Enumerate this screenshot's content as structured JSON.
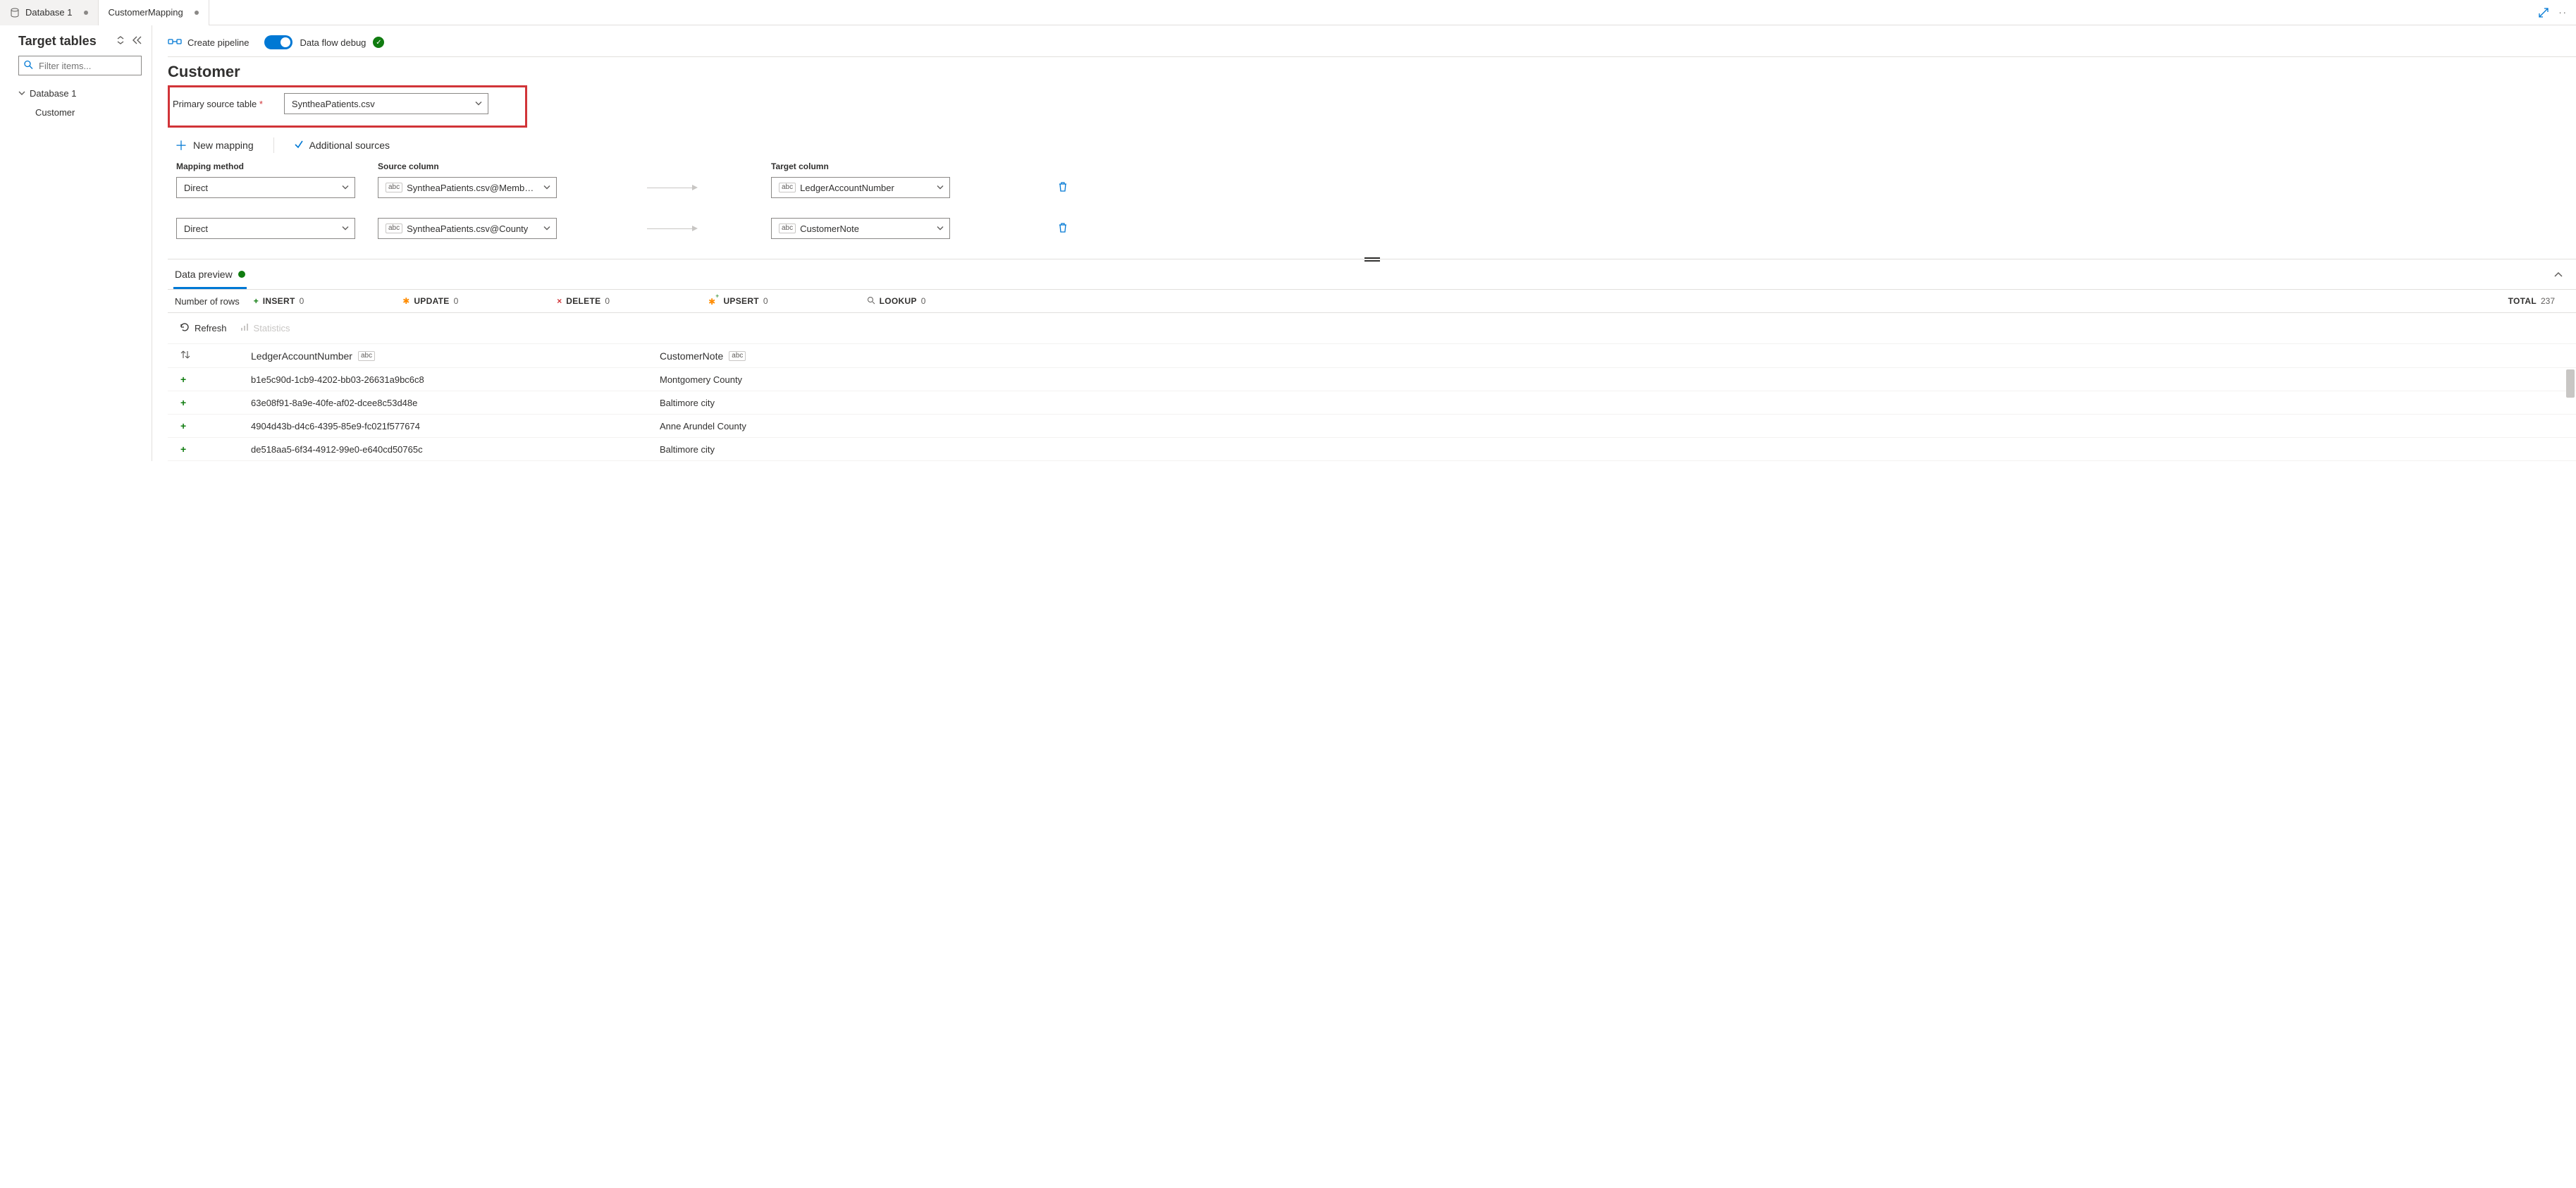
{
  "tabs": [
    {
      "label": "Database 1",
      "active": false
    },
    {
      "label": "CustomerMapping",
      "active": true
    }
  ],
  "sidebar": {
    "title": "Target tables",
    "filter_placeholder": "Filter items...",
    "tree": {
      "root_label": "Database 1",
      "children": [
        {
          "label": "Customer"
        }
      ]
    }
  },
  "toolbar": {
    "create_pipeline": "Create pipeline",
    "debug_label": "Data flow debug",
    "debug_on": true
  },
  "heading": "Customer",
  "primary_source": {
    "label": "Primary source table",
    "required": true,
    "value": "SyntheaPatients.csv"
  },
  "mapping_actions": {
    "new_mapping": "New mapping",
    "additional_sources": "Additional sources"
  },
  "mapping_header": {
    "method": "Mapping method",
    "source": "Source column",
    "target": "Target column"
  },
  "mappings": [
    {
      "method": "Direct",
      "source": "SyntheaPatients.csv@Member id",
      "target": "LedgerAccountNumber"
    },
    {
      "method": "Direct",
      "source": "SyntheaPatients.csv@County",
      "target": "CustomerNote"
    }
  ],
  "preview": {
    "tab_label": "Data preview",
    "rows_label": "Number of rows",
    "stats": {
      "insert": {
        "label": "INSERT",
        "value": "0"
      },
      "update": {
        "label": "UPDATE",
        "value": "0"
      },
      "delete": {
        "label": "DELETE",
        "value": "0"
      },
      "upsert": {
        "label": "UPSERT",
        "value": "0"
      },
      "lookup": {
        "label": "LOOKUP",
        "value": "0"
      },
      "total": {
        "label": "TOTAL",
        "value": "237"
      }
    },
    "refresh_label": "Refresh",
    "statistics_label": "Statistics",
    "columns": [
      {
        "name": "LedgerAccountNumber",
        "type": "abc"
      },
      {
        "name": "CustomerNote",
        "type": "abc"
      }
    ],
    "rows": [
      {
        "c1": "b1e5c90d-1cb9-4202-bb03-26631a9bc6c8",
        "c2": "Montgomery County"
      },
      {
        "c1": "63e08f91-8a9e-40fe-af02-dcee8c53d48e",
        "c2": "Baltimore city"
      },
      {
        "c1": "4904d43b-d4c6-4395-85e9-fc021f577674",
        "c2": "Anne Arundel County"
      },
      {
        "c1": "de518aa5-6f34-4912-99e0-e640cd50765c",
        "c2": "Baltimore city"
      }
    ]
  }
}
